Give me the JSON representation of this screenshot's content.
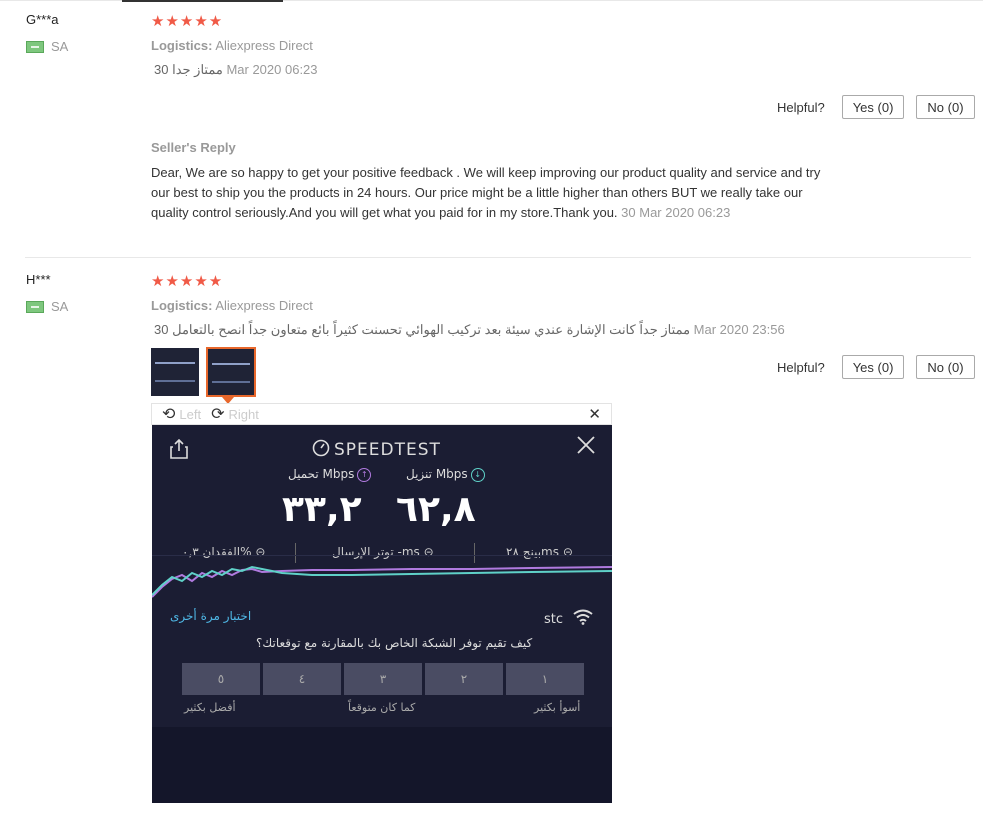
{
  "reviews": [
    {
      "username": "G***a",
      "country": "SA",
      "stars": "★★★★★",
      "logistics_label": "Logistics:",
      "logistics_value": "Aliexpress Direct",
      "feedback_text": "ممتاز جدا",
      "feedback_num": "30",
      "date": "Mar 2020 06:23",
      "helpful_label": "Helpful?",
      "yes_label": "Yes (0)",
      "no_label": "No (0)",
      "seller_reply_title": "Seller's Reply",
      "seller_reply_text": "Dear, We are so happy to get your positive feedback . We will keep improving our product quality and service and try our best to ship you the products in 24 hours. Our price might be a little higher than others BUT we really take our quality control seriously.And you will get what you paid for in my store.Thank you.",
      "seller_reply_date": "30 Mar 2020 06:23"
    },
    {
      "username": "H***",
      "country": "SA",
      "stars": "★★★★★",
      "logistics_label": "Logistics:",
      "logistics_value": "Aliexpress Direct",
      "feedback_text": "ممتاز جداً كانت الإشارة عندي سيئة بعد تركيب الهوائي تحسنت كثيراً بائع متعاون جداً انصح بالتعامل",
      "feedback_num": "30",
      "date": "Mar 2020 23:56",
      "helpful_label": "Helpful?",
      "yes_label": "Yes (0)",
      "no_label": "No (0)"
    }
  ],
  "viewer": {
    "left_label": "Left",
    "right_label": "Right",
    "rotate_left_icon": "⟲",
    "rotate_right_icon": "⟳",
    "close_icon": "✕"
  },
  "speedtest": {
    "title": "SPEEDTEST",
    "upload_label": "تحميل Mbps",
    "download_label": "تنزيل Mbps",
    "upload_value": "٣٣,٢",
    "download_value": "٦٢,٨",
    "loss_label": "الفقدان ٠,٣%",
    "jitter_label": "توتر الإرسال -ms",
    "ping_label": "بينج ٢٨ms",
    "retry_label": "اختبار مرة أخرى",
    "provider": "stc",
    "question": "كيف تقيم توفر الشبكة الخاص بك بالمقارنة مع توقعاتك؟",
    "rating_boxes": [
      "٥",
      "٤",
      "٣",
      "٢",
      "١"
    ],
    "scale_best": "أفضل بكثير",
    "scale_expected": "كما كان متوقعاً",
    "scale_worst": "أسوأ بكثير"
  }
}
